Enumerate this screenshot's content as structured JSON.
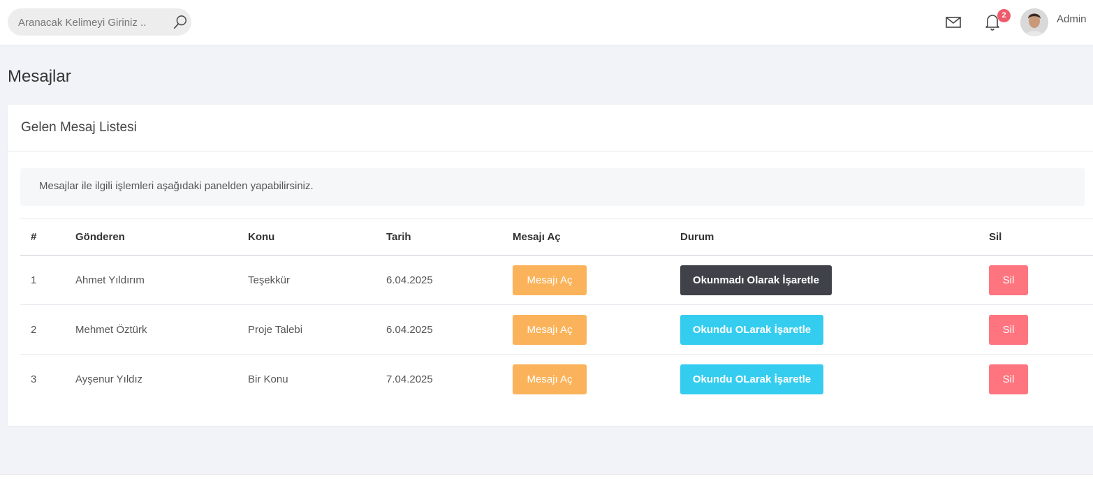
{
  "topbar": {
    "search_placeholder": "Aranacak Kelimeyi Giriniz ..",
    "notification_count": "2",
    "user_name": "Admin",
    "icons": [
      "search-icon",
      "mail-icon",
      "bell-icon",
      "avatar"
    ]
  },
  "page": {
    "title": "Mesajlar"
  },
  "card": {
    "title": "Gelen Mesaj Listesi",
    "info": "Mesajlar ile ilgili işlemleri aşağıdaki panelden yapabilirsiniz.",
    "columns": [
      "#",
      "Gönderen",
      "Konu",
      "Tarih",
      "Mesajı Aç",
      "Durum",
      "Sil"
    ],
    "rows": [
      {
        "no": "1",
        "sender": "Ahmet Yıldırım",
        "subject": "Teşekkür",
        "date": "6.04.2025",
        "open_label": "Mesajı Aç",
        "status_label": "Okunmadı Olarak İşaretle",
        "status_style": "dark",
        "delete_label": "Sil"
      },
      {
        "no": "2",
        "sender": "Mehmet Öztürk",
        "subject": "Proje Talebi",
        "date": "6.04.2025",
        "open_label": "Mesajı Aç",
        "status_label": "Okundu OLarak İşaretle",
        "status_style": "info",
        "delete_label": "Sil"
      },
      {
        "no": "3",
        "sender": "Ayşenur Yıldız",
        "subject": "Bir Konu",
        "date": "7.04.2025",
        "open_label": "Mesajı Aç",
        "status_label": "Okundu OLarak İşaretle",
        "status_style": "info",
        "delete_label": "Sil"
      }
    ]
  },
  "colors": {
    "warning": "#fbb35b",
    "dark": "#3f4349",
    "info": "#35cdef",
    "danger": "#fe7580",
    "badge": "#ef5a6a",
    "background": "#f2f3f8"
  }
}
